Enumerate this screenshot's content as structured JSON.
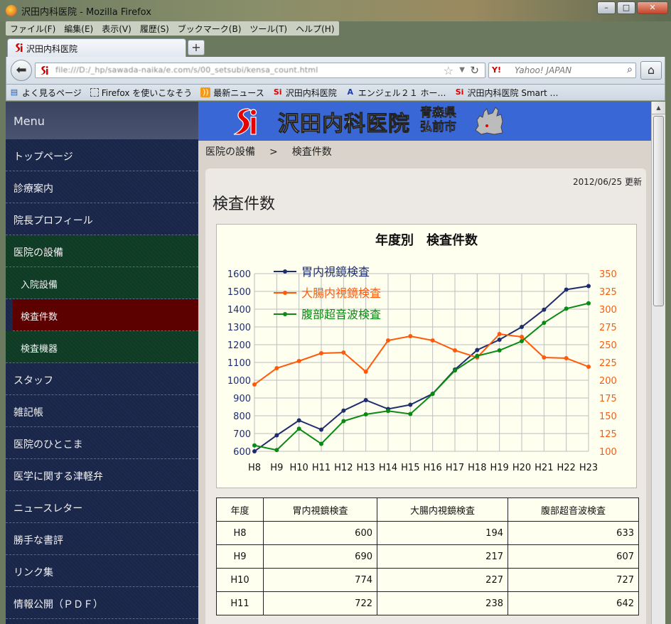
{
  "window": {
    "title": "沢田内科医院 - Mozilla Firefox",
    "controls": {
      "minimize": "–",
      "maximize": "□",
      "close": "✕"
    }
  },
  "menubar": [
    "ファイル(F)",
    "編集(E)",
    "表示(V)",
    "履歴(S)",
    "ブックマーク(B)",
    "ツール(T)",
    "ヘルプ(H)"
  ],
  "tab": {
    "label": "沢田内科医院",
    "new_tab": "+"
  },
  "nav": {
    "url": "file:///D:/_hp/sawada-naika/e.com/s/00_setsubi/kensa_count.html",
    "search_placeholder": "Yahoo! JAPAN",
    "search_engine": "Y!"
  },
  "bookmarks": [
    "よく見るページ",
    "Firefox を使いこなそう",
    "最新ニュース",
    "沢田内科医院",
    "エンジェル２１ ホー…",
    "沢田内科医院 Smart …"
  ],
  "sidebar": {
    "header": "Menu",
    "items": [
      {
        "label": "トップページ"
      },
      {
        "label": "診療案内"
      },
      {
        "label": "院長プロフィール"
      },
      {
        "label": "医院の設備"
      },
      {
        "label": "入院設備"
      },
      {
        "label": "検査件数"
      },
      {
        "label": "検査機器"
      },
      {
        "label": "スタッフ"
      },
      {
        "label": "雑記帳"
      },
      {
        "label": "医院のひとこま"
      },
      {
        "label": "医学に関する津軽弁"
      },
      {
        "label": "ニュースレター"
      },
      {
        "label": "勝手な書評"
      },
      {
        "label": "リンク集"
      },
      {
        "label": "情報公開（ＰＤＦ）"
      }
    ]
  },
  "banner": {
    "logo_text": "沢田内科医院",
    "pref_line1": "青森県",
    "pref_line2": "弘前市"
  },
  "breadcrumb": {
    "parent": "医院の設備",
    "sep": ">",
    "current": "検査件数"
  },
  "main": {
    "updated": "2012/06/25 更新",
    "heading": "検査件数"
  },
  "colors": {
    "gastro": "#1f2d6e",
    "colon": "#ff5a0a",
    "echo": "#0a8a14"
  },
  "chart_data": {
    "type": "line",
    "title": "年度別　検査件数",
    "categories": [
      "H8",
      "H9",
      "H10",
      "H11",
      "H12",
      "H13",
      "H14",
      "H15",
      "H16",
      "H17",
      "H18",
      "H19",
      "H20",
      "H21",
      "H22",
      "H23"
    ],
    "y_left": {
      "min": 600,
      "max": 1600,
      "ticks": [
        "1600",
        "1500",
        "1400",
        "1300",
        "1200",
        "1100",
        "1000",
        "900",
        "800",
        "700",
        "600"
      ]
    },
    "y_right": {
      "min": 100,
      "max": 350,
      "ticks": [
        "350",
        "325",
        "300",
        "275",
        "250",
        "225",
        "200",
        "175",
        "150",
        "125",
        "100"
      ]
    },
    "grid": true,
    "legend": "top-left",
    "series": [
      {
        "name": "胃内視鏡検査",
        "axis": "left",
        "color": "#1f2d6e",
        "values": [
          600,
          690,
          774,
          722,
          829,
          888,
          838,
          862,
          924,
          1060,
          1170,
          1228,
          1300,
          1397,
          1510,
          1530
        ]
      },
      {
        "name": "大腸内視鏡検査",
        "axis": "right",
        "color": "#ff5a0a",
        "values": [
          194,
          217,
          227,
          238,
          239,
          212,
          256,
          262,
          256,
          242,
          232,
          265,
          261,
          232,
          231,
          219
        ]
      },
      {
        "name": "腹部超音波検査",
        "axis": "left",
        "color": "#0a8a14",
        "values": [
          633,
          607,
          727,
          642,
          770,
          808,
          827,
          810,
          923,
          1055,
          1137,
          1168,
          1220,
          1323,
          1403,
          1433
        ]
      }
    ]
  },
  "table": {
    "headers": [
      "年度",
      "胃内視鏡検査",
      "大腸内視鏡検査",
      "腹部超音波検査"
    ],
    "rows": [
      [
        "H8",
        "600",
        "194",
        "633"
      ],
      [
        "H9",
        "690",
        "217",
        "607"
      ],
      [
        "H10",
        "774",
        "227",
        "727"
      ],
      [
        "H11",
        "722",
        "238",
        "642"
      ]
    ]
  }
}
